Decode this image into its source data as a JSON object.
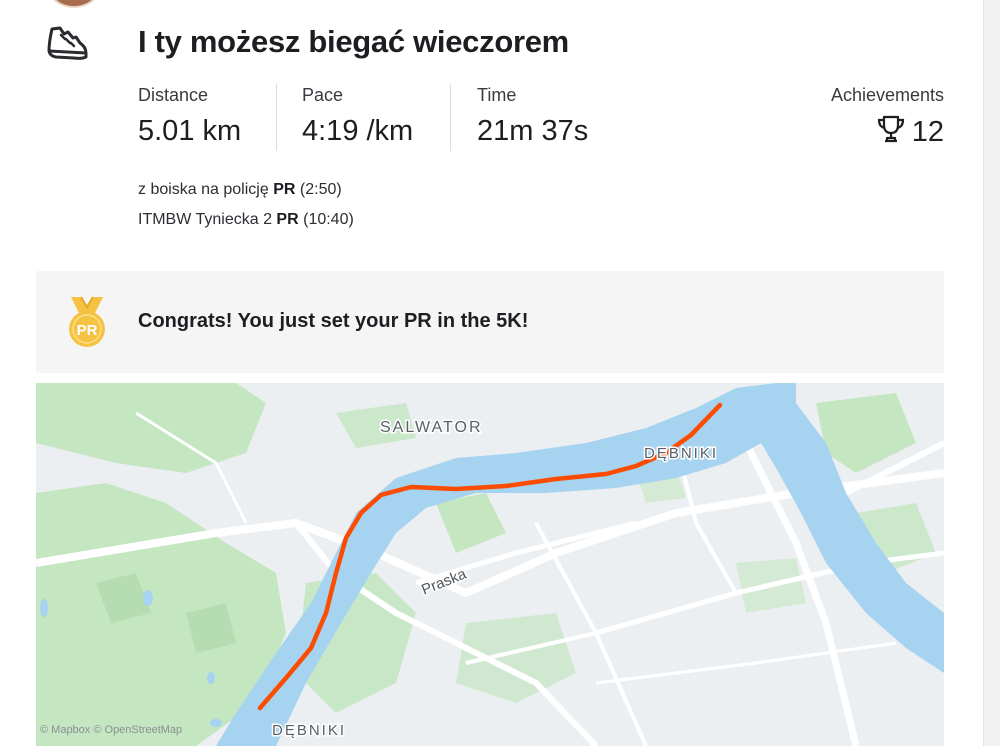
{
  "activity": {
    "title": "I ty możesz biegać wieczorem",
    "sport_icon": "running-shoe-icon"
  },
  "stats": [
    {
      "label": "Distance",
      "value": "5.01 km"
    },
    {
      "label": "Pace",
      "value": "4:19 /km"
    },
    {
      "label": "Time",
      "value": "21m 37s"
    }
  ],
  "achievements": {
    "label": "Achievements",
    "count": "12",
    "icon": "trophy-icon"
  },
  "segments": [
    {
      "name": "z boiska na policję",
      "badge": "PR",
      "time": "(2:50)"
    },
    {
      "name": "ITMBW Tyniecka 2",
      "badge": "PR",
      "time": "(10:40)"
    }
  ],
  "banner": {
    "icon": "pr-medal-icon",
    "medal_text": "PR",
    "text": "Congrats! You just set your PR in the 5K!"
  },
  "map": {
    "labels": {
      "salwator": "SALWATOR",
      "debniki_top": "DĘBNIKI",
      "debniki_bottom": "DĘBNIKI",
      "street": "Praska"
    },
    "attribution": "© Mapbox © OpenStreetMap",
    "route_color": "#fc4c02",
    "river_color": "#a6d3f0",
    "park_color": "#c4e6c1"
  }
}
